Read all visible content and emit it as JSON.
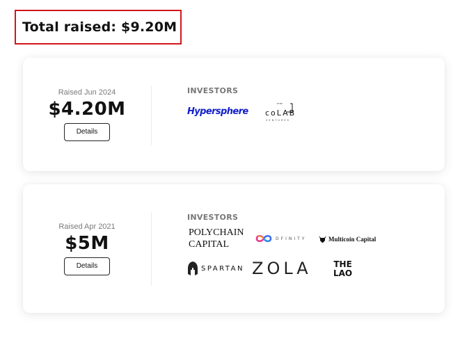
{
  "summary": {
    "total_raised": "Total raised: $9.20M"
  },
  "rounds": [
    {
      "raised_date": "Raised Jun 2024",
      "amount": "$4.20M",
      "details_label": "Details",
      "investors_label": "INVESTORS",
      "investors": [
        {
          "name": "Hypersphere",
          "icon": "hypersphere-logo",
          "color": "#1320c9"
        },
        {
          "name": "coLAB",
          "top": "ETHE",
          "sub": "VENTURES",
          "icon": "colab-ventures-logo"
        }
      ]
    },
    {
      "raised_date": "Raised Apr 2021",
      "amount": "$5M",
      "details_label": "Details",
      "investors_label": "INVESTORS",
      "investors": [
        {
          "name_line1": "POLYCHAIN",
          "name_line2": "CAPITAL",
          "icon": "polychain-capital-logo"
        },
        {
          "name": "DFINITY",
          "icon": "dfinity-infinity-logo"
        },
        {
          "name": "Multicoin Capital",
          "icon": "multicoin-capital-logo"
        },
        {
          "name": "SPARTAN",
          "icon": "spartan-helmet-logo"
        },
        {
          "name": "ZOLA",
          "icon": "zola-logo"
        },
        {
          "name_line1": "THE",
          "name_line2": "LAO",
          "icon": "the-lao-logo"
        }
      ]
    }
  ],
  "colors": {
    "highlight_border": "#d0161c",
    "card_bg": "#ffffff"
  }
}
